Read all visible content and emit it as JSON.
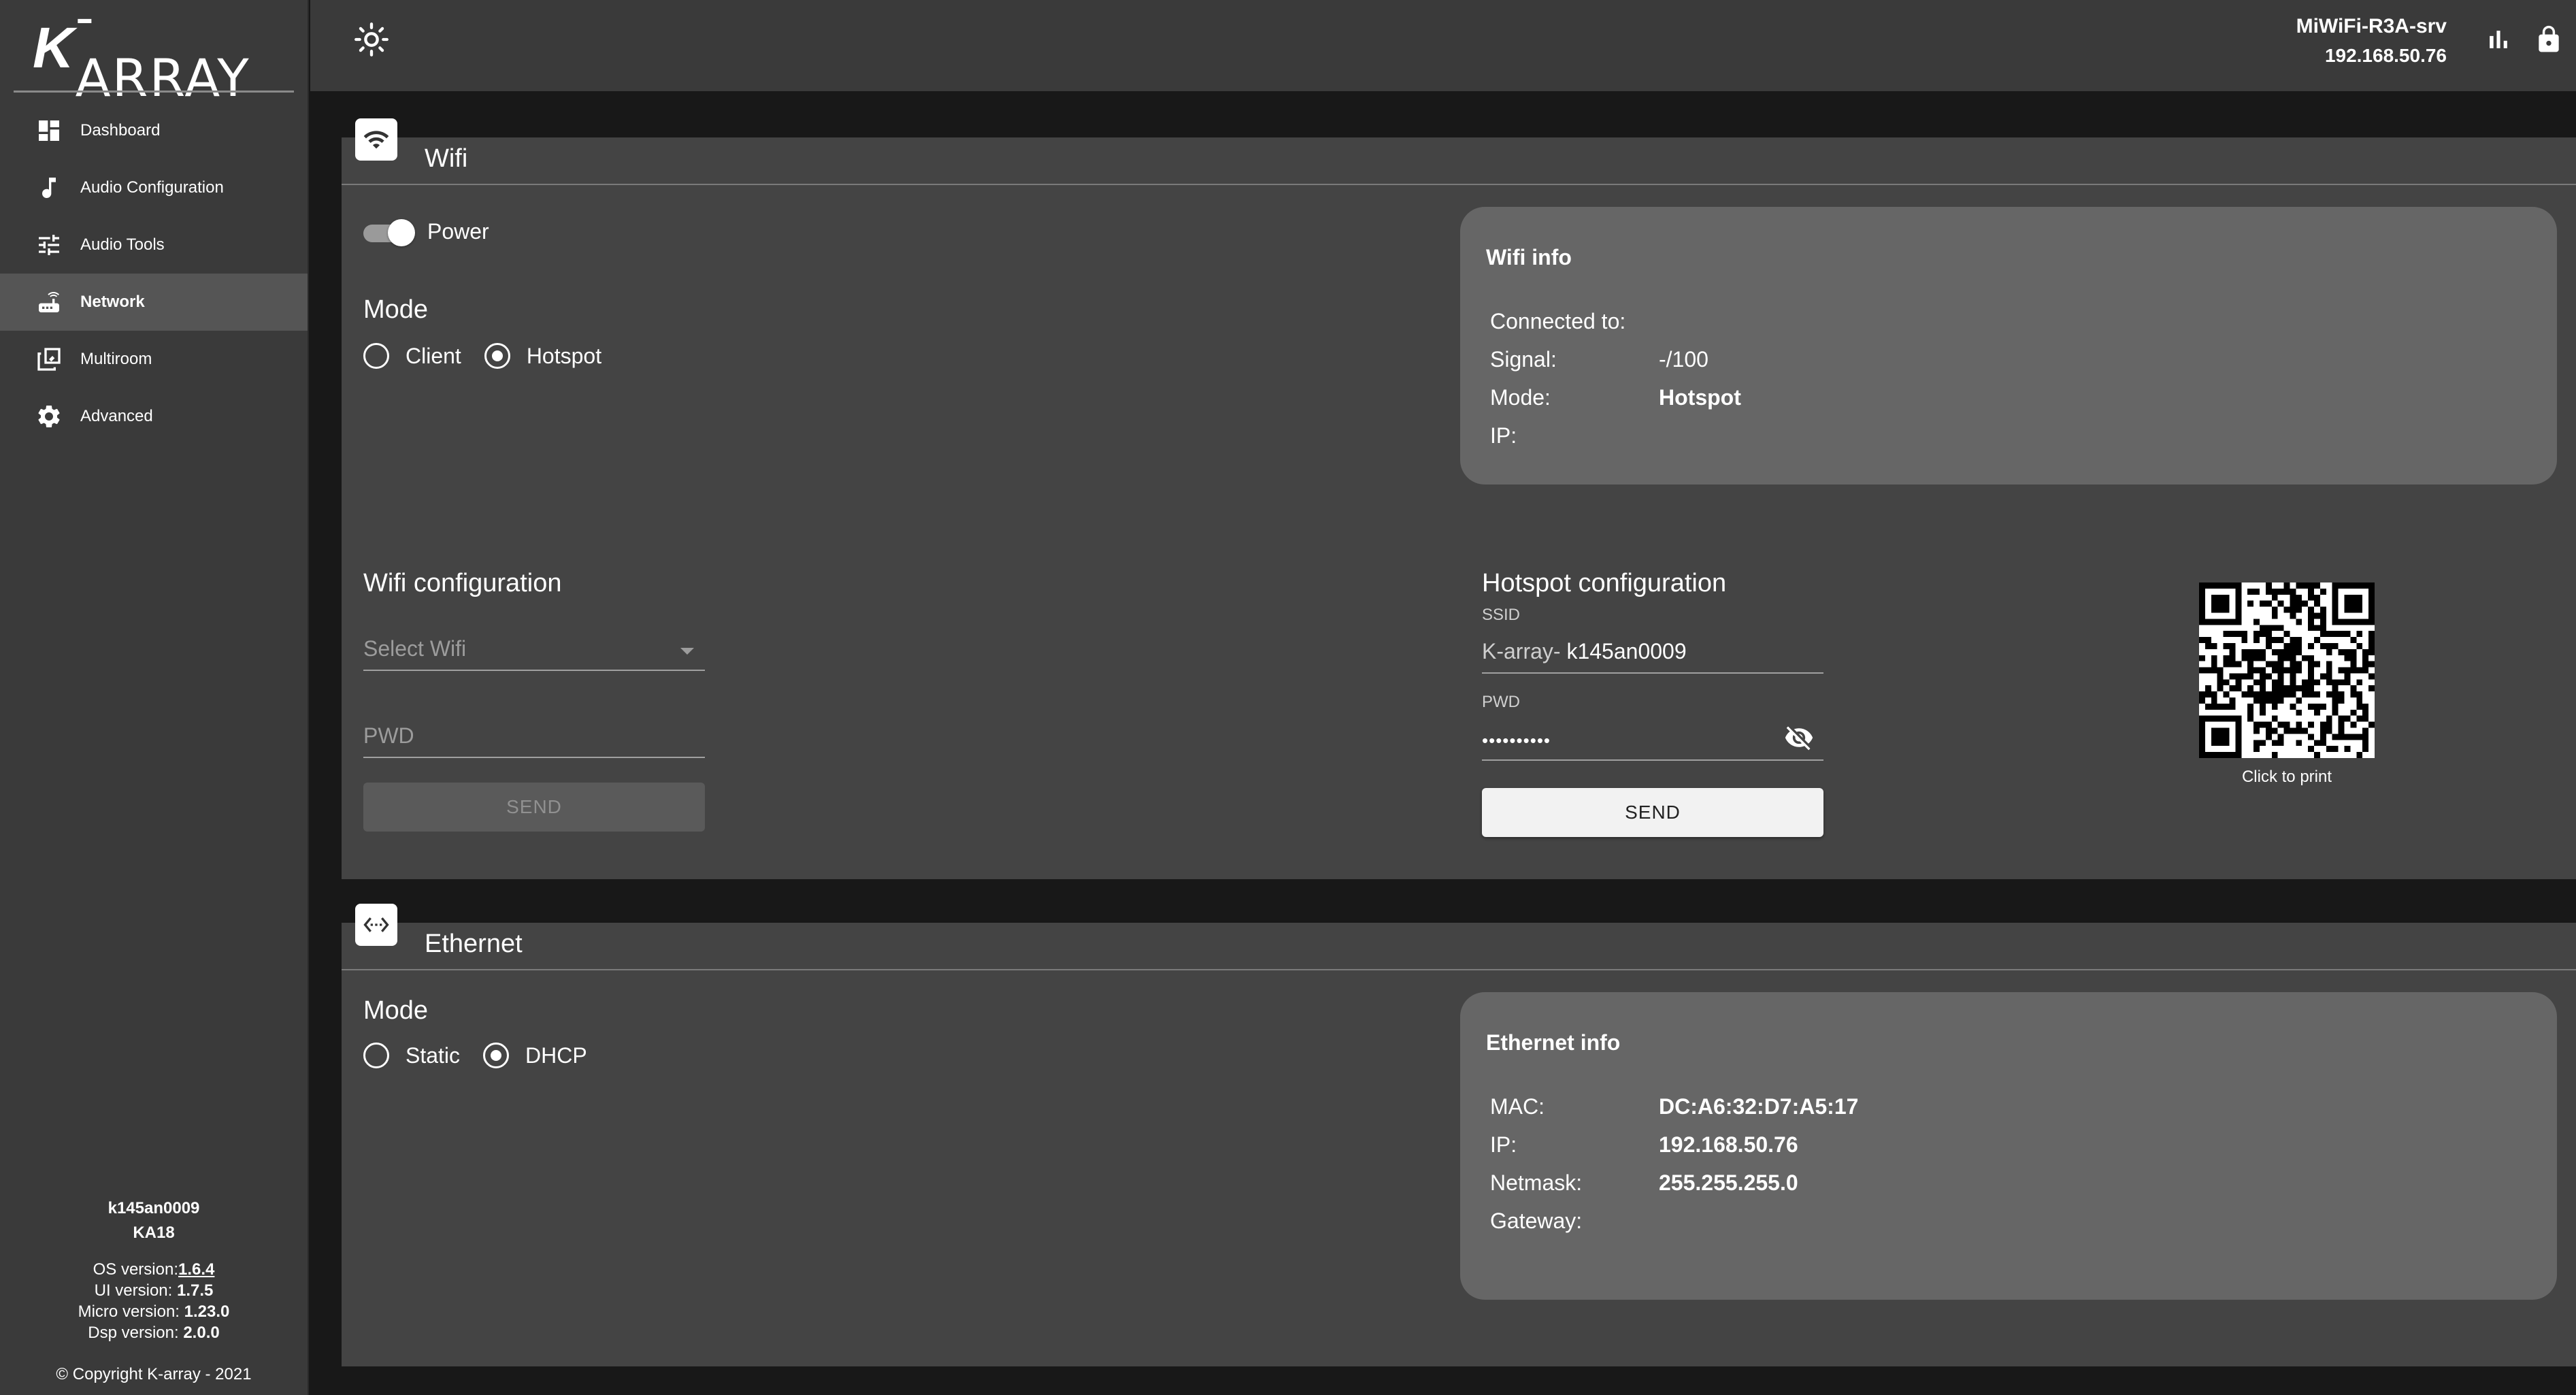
{
  "brand": {
    "logo_k": "K",
    "logo_rest": "-ARRAY"
  },
  "sidebar": {
    "items": [
      {
        "label": "Dashboard",
        "icon": "dashboard-icon",
        "active": false
      },
      {
        "label": "Audio Configuration",
        "icon": "music-note-icon",
        "active": false
      },
      {
        "label": "Audio Tools",
        "icon": "sliders-icon",
        "active": false
      },
      {
        "label": "Network",
        "icon": "router-icon",
        "active": true
      },
      {
        "label": "Multiroom",
        "icon": "multiroom-icon",
        "active": false
      },
      {
        "label": "Advanced",
        "icon": "gear-icon",
        "active": false
      }
    ],
    "device_serial": "k145an0009",
    "device_model": "KA18",
    "os_version_label": "OS version:",
    "os_version": "1.6.4",
    "ui_version_label": "UI version:",
    "ui_version": "1.7.5",
    "micro_version_label": "Micro version:",
    "micro_version": "1.23.0",
    "dsp_version_label": "Dsp version:",
    "dsp_version": "2.0.0",
    "copyright": "© Copyright K-array - 2021"
  },
  "topbar": {
    "theme_icon": "sun-icon",
    "network_name": "MiWiFi-R3A-srv",
    "network_ip": "192.168.50.76",
    "stats_icon": "bar-chart-icon",
    "lock_icon": "lock-icon"
  },
  "wifi": {
    "title": "Wifi",
    "icon": "wifi-icon",
    "power_label": "Power",
    "power_on": true,
    "mode_title": "Mode",
    "mode_options": [
      "Client",
      "Hotspot"
    ],
    "mode_selected": "Hotspot",
    "info": {
      "title": "Wifi info",
      "connected_label": "Connected to:",
      "connected_value": "",
      "signal_label": "Signal:",
      "signal_value": "-/100",
      "mode_label": "Mode:",
      "mode_value": "Hotspot",
      "ip_label": "IP:",
      "ip_value": ""
    },
    "config": {
      "title": "Wifi configuration",
      "select_placeholder": "Select Wifi",
      "pwd_placeholder": "PWD",
      "send_label": "SEND"
    },
    "hotspot": {
      "title": "Hotspot configuration",
      "ssid_label": "SSID",
      "ssid_prefix": "K-array-",
      "ssid_value": "k145an0009",
      "pwd_label": "PWD",
      "pwd_value": "••••••••••",
      "send_label": "SEND",
      "qr_caption": "Click to print"
    }
  },
  "ethernet": {
    "title": "Ethernet",
    "icon": "ethernet-icon",
    "mode_title": "Mode",
    "mode_options": [
      "Static",
      "DHCP"
    ],
    "mode_selected": "DHCP",
    "info": {
      "title": "Ethernet info",
      "mac_label": "MAC:",
      "mac_value": "DC:A6:32:D7:A5:17",
      "ip_label": "IP:",
      "ip_value": "192.168.50.76",
      "netmask_label": "Netmask:",
      "netmask_value": "255.255.255.0",
      "gateway_label": "Gateway:",
      "gateway_value": ""
    }
  }
}
